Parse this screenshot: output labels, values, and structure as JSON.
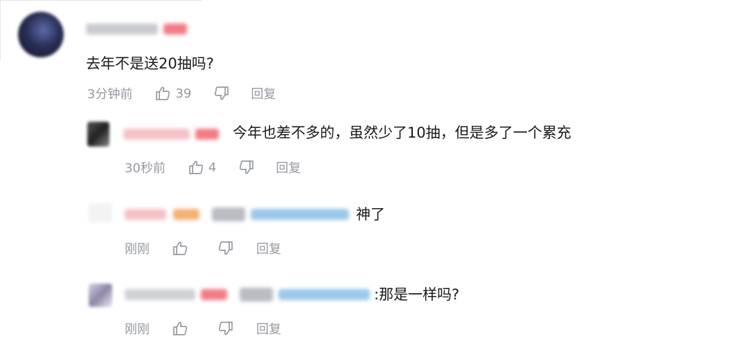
{
  "comments": [
    {
      "text": "去年不是送20抽吗?",
      "time": "3分钟前",
      "likes": "39",
      "reply_label": "回复"
    },
    {
      "text": "今年也差不多的，虽然少了10抽，但是多了一个累充",
      "time": "30秒前",
      "likes": "4",
      "reply_label": "回复"
    },
    {
      "text": "神了",
      "time": "刚刚",
      "likes": "",
      "reply_label": "回复"
    },
    {
      "text": ":那是一样吗?",
      "time": "刚刚",
      "likes": "",
      "reply_label": "回复"
    }
  ],
  "colors": {
    "meta_gray": "#9499a0",
    "text": "#18191c",
    "mention_blue": "#9cc8ea",
    "vip_pink": "#f5a3ad",
    "level_red": "#f27c86",
    "level_orange": "#f5b072"
  },
  "icons": {
    "like": "thumbs-up-icon",
    "dislike": "thumbs-down-icon"
  }
}
